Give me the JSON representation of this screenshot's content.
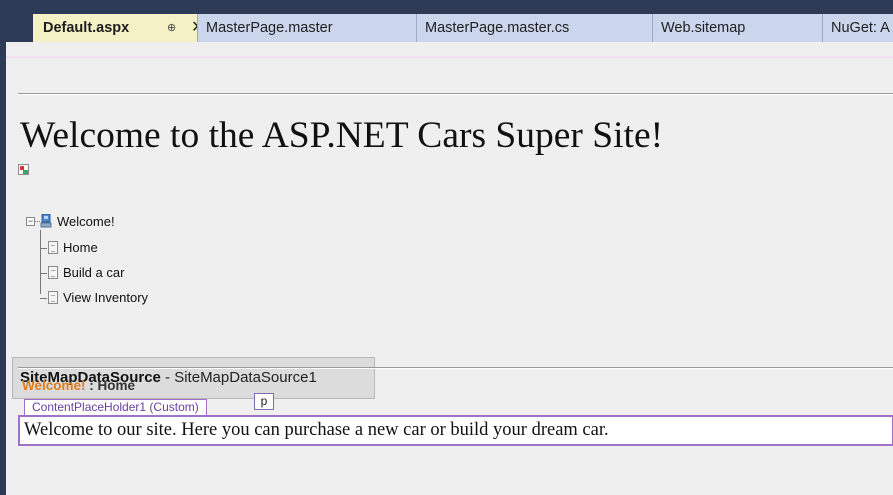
{
  "tabs": [
    {
      "label": "Default.aspx",
      "pin": "⊕",
      "close": "✕"
    },
    {
      "label": "MasterPage.master"
    },
    {
      "label": "MasterPage.master.cs"
    },
    {
      "label": "Web.sitemap"
    },
    {
      "label": "NuGet: A"
    }
  ],
  "page": {
    "title": "Welcome to the ASP.NET Cars Super Site!",
    "tree": {
      "expander": "−",
      "root": "Welcome!",
      "items": [
        "Home",
        "Build a car",
        "View Inventory"
      ]
    },
    "sitemap_control": {
      "type": "SiteMapDataSource",
      "separator": " - ",
      "id": "SiteMapDataSource1"
    },
    "breadcrumb": {
      "root": "Welcome!",
      "separator": " : ",
      "current": "Home"
    },
    "content_placeholder": {
      "label": "ContentPlaceHolder1 (Custom)",
      "tag": "p",
      "text": "Welcome to our site.  Here you can purchase a new car or build your dream car."
    }
  },
  "colors": {
    "tabbar": "#2d3a55",
    "active_tab": "#f5f1c6",
    "inactive_tab": "#cbd6ec",
    "breadcrumb_root": "#e07b1a",
    "placeholder_border": "#a071c8"
  }
}
